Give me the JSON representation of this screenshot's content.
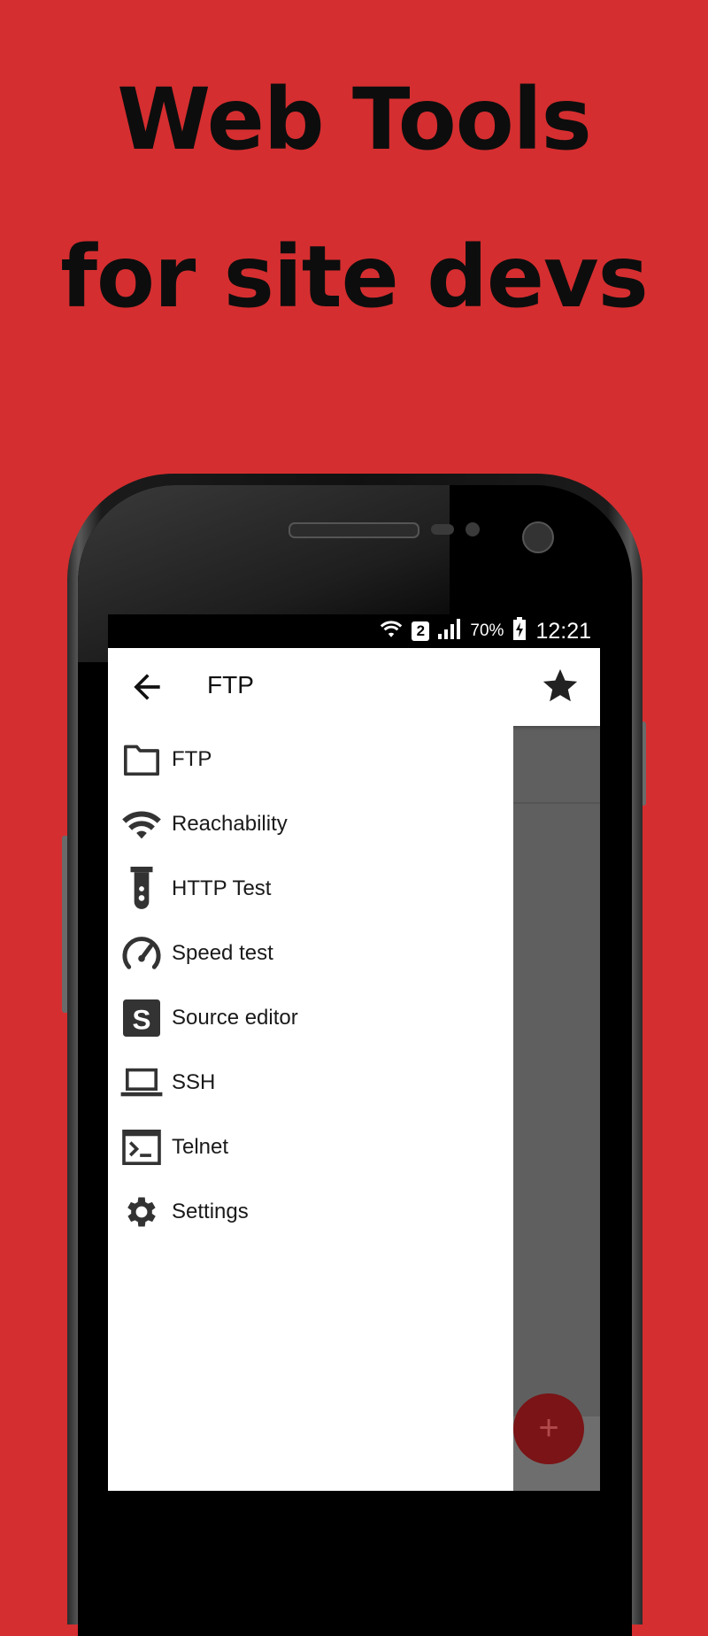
{
  "promo": {
    "headline_line1": "Web Tools",
    "headline_line2": "for site devs"
  },
  "status_bar": {
    "sim_slot": "2",
    "battery": "70%",
    "time": "12:21",
    "icons": [
      "wifi-icon",
      "signal-icon",
      "battery-charging-icon"
    ]
  },
  "app_bar": {
    "title": "FTP",
    "back_icon": "arrow-back-icon",
    "favorite_icon": "star-icon"
  },
  "drawer": {
    "items": [
      {
        "label": "FTP",
        "icon": "folder-icon"
      },
      {
        "label": "Reachability",
        "icon": "wifi-icon"
      },
      {
        "label": "HTTP Test",
        "icon": "test-tube-icon"
      },
      {
        "label": "Speed test",
        "icon": "speedometer-icon"
      },
      {
        "label": "Source editor",
        "icon": "source-s-icon"
      },
      {
        "label": "SSH",
        "icon": "laptop-icon"
      },
      {
        "label": "Telnet",
        "icon": "terminal-icon"
      },
      {
        "label": "Settings",
        "icon": "gear-icon"
      }
    ]
  },
  "fab": {
    "label": "+",
    "icon": "plus-icon"
  },
  "colors": {
    "background": "#d52e30",
    "fab": "#7a1416",
    "icon": "#333333"
  }
}
